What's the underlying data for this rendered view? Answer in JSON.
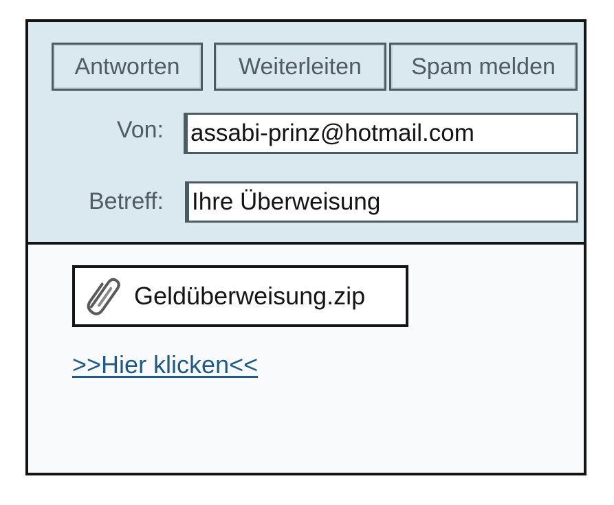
{
  "toolbar": {
    "reply_label": "Antworten",
    "forward_label": "Weiterleiten",
    "spam_label": "Spam melden"
  },
  "fields": {
    "from_label": "Von:",
    "from_value": "assabi-prinz@hotmail.com",
    "subject_label": "Betreff:",
    "subject_value": "Ihre Überweisung"
  },
  "body": {
    "attachment": {
      "icon": "paperclip-icon",
      "name": "Geldüberweisung.zip"
    },
    "link_text": ">>Hier klicken<<"
  },
  "colors": {
    "header_bg": "#d9e9ef",
    "body_bg": "#f8fafc",
    "link": "#215a86",
    "label_text": "#4f5c62"
  }
}
